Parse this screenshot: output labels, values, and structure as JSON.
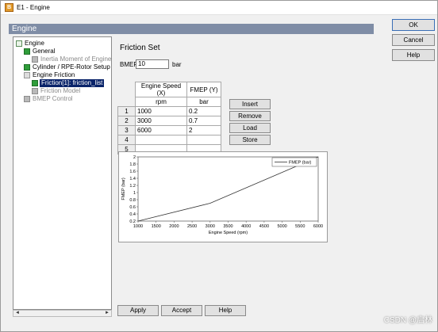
{
  "window": {
    "title": "E1 - Engine",
    "icon": "B"
  },
  "panel_title": "Engine",
  "tree": {
    "items": [
      {
        "label": "Engine",
        "icon": "root-icon"
      },
      {
        "label": "General",
        "icon": "green-icon"
      },
      {
        "label": "Inertia Moment of Engine -",
        "icon": "gray-icon"
      },
      {
        "label": "Cylinder / RPE-Rotor Setup",
        "icon": "green-icon"
      },
      {
        "label": "Engine Friction",
        "icon": "doc-icon"
      },
      {
        "label": "Friction[1]: friction_list",
        "icon": "green-icon"
      },
      {
        "label": "Friction Model",
        "icon": "gray-icon"
      },
      {
        "label": "BMEP Control",
        "icon": "gray-icon"
      }
    ],
    "scroll_left": "◄",
    "scroll_right": "►"
  },
  "friction": {
    "title": "Friction Set",
    "bmep_label": "BMEP",
    "bmep_value": "10",
    "bmep_unit": "bar"
  },
  "table": {
    "headers": [
      "Engine Speed (X)",
      "FMEP (Y)"
    ],
    "units": [
      "rpm",
      "bar"
    ],
    "rows": [
      {
        "num": "1",
        "x": "1000",
        "y": "0.2"
      },
      {
        "num": "2",
        "x": "3000",
        "y": "0.7"
      },
      {
        "num": "3",
        "x": "6000",
        "y": "2"
      },
      {
        "num": "4",
        "x": "",
        "y": ""
      },
      {
        "num": "5",
        "x": "",
        "y": ""
      }
    ]
  },
  "table_buttons": [
    "Insert",
    "Remove",
    "Load",
    "Store"
  ],
  "chart_data": {
    "type": "line",
    "x": [
      1000,
      3000,
      6000
    ],
    "series": [
      {
        "name": "FMEP (bar)",
        "values": [
          0.2,
          0.7,
          2
        ]
      }
    ],
    "xlabel": "Engine Speed (rpm)",
    "ylabel": "FMEP (bar)",
    "xlim": [
      1000,
      6000
    ],
    "ylim": [
      0.2,
      2
    ],
    "xticks": [
      "1000",
      "1500",
      "2000",
      "2500",
      "3000",
      "3500",
      "4000",
      "4500",
      "5000",
      "5500",
      "6000"
    ],
    "yticks": [
      "0.2",
      "0.4",
      "0.6",
      "0.8",
      "1",
      "1.2",
      "1.4",
      "1.6",
      "1.8",
      "2"
    ],
    "legend": "top-right",
    "line_color": "#333333"
  },
  "bottom_buttons": {
    "apply": "Apply",
    "accept": "Accept",
    "help": "Help"
  },
  "side_buttons": {
    "ok": "OK",
    "cancel": "Cancel",
    "help": "Help"
  },
  "watermark": "CSDN @启林"
}
